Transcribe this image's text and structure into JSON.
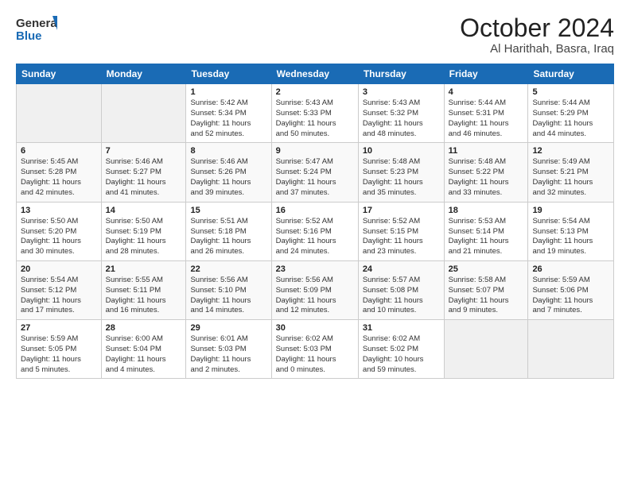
{
  "header": {
    "logo_line1": "General",
    "logo_line2": "Blue",
    "month": "October 2024",
    "location": "Al Harithah, Basra, Iraq"
  },
  "weekdays": [
    "Sunday",
    "Monday",
    "Tuesday",
    "Wednesday",
    "Thursday",
    "Friday",
    "Saturday"
  ],
  "weeks": [
    [
      {
        "day": "",
        "info": ""
      },
      {
        "day": "",
        "info": ""
      },
      {
        "day": "1",
        "info": "Sunrise: 5:42 AM\nSunset: 5:34 PM\nDaylight: 11 hours\nand 52 minutes."
      },
      {
        "day": "2",
        "info": "Sunrise: 5:43 AM\nSunset: 5:33 PM\nDaylight: 11 hours\nand 50 minutes."
      },
      {
        "day": "3",
        "info": "Sunrise: 5:43 AM\nSunset: 5:32 PM\nDaylight: 11 hours\nand 48 minutes."
      },
      {
        "day": "4",
        "info": "Sunrise: 5:44 AM\nSunset: 5:31 PM\nDaylight: 11 hours\nand 46 minutes."
      },
      {
        "day": "5",
        "info": "Sunrise: 5:44 AM\nSunset: 5:29 PM\nDaylight: 11 hours\nand 44 minutes."
      }
    ],
    [
      {
        "day": "6",
        "info": "Sunrise: 5:45 AM\nSunset: 5:28 PM\nDaylight: 11 hours\nand 42 minutes."
      },
      {
        "day": "7",
        "info": "Sunrise: 5:46 AM\nSunset: 5:27 PM\nDaylight: 11 hours\nand 41 minutes."
      },
      {
        "day": "8",
        "info": "Sunrise: 5:46 AM\nSunset: 5:26 PM\nDaylight: 11 hours\nand 39 minutes."
      },
      {
        "day": "9",
        "info": "Sunrise: 5:47 AM\nSunset: 5:24 PM\nDaylight: 11 hours\nand 37 minutes."
      },
      {
        "day": "10",
        "info": "Sunrise: 5:48 AM\nSunset: 5:23 PM\nDaylight: 11 hours\nand 35 minutes."
      },
      {
        "day": "11",
        "info": "Sunrise: 5:48 AM\nSunset: 5:22 PM\nDaylight: 11 hours\nand 33 minutes."
      },
      {
        "day": "12",
        "info": "Sunrise: 5:49 AM\nSunset: 5:21 PM\nDaylight: 11 hours\nand 32 minutes."
      }
    ],
    [
      {
        "day": "13",
        "info": "Sunrise: 5:50 AM\nSunset: 5:20 PM\nDaylight: 11 hours\nand 30 minutes."
      },
      {
        "day": "14",
        "info": "Sunrise: 5:50 AM\nSunset: 5:19 PM\nDaylight: 11 hours\nand 28 minutes."
      },
      {
        "day": "15",
        "info": "Sunrise: 5:51 AM\nSunset: 5:18 PM\nDaylight: 11 hours\nand 26 minutes."
      },
      {
        "day": "16",
        "info": "Sunrise: 5:52 AM\nSunset: 5:16 PM\nDaylight: 11 hours\nand 24 minutes."
      },
      {
        "day": "17",
        "info": "Sunrise: 5:52 AM\nSunset: 5:15 PM\nDaylight: 11 hours\nand 23 minutes."
      },
      {
        "day": "18",
        "info": "Sunrise: 5:53 AM\nSunset: 5:14 PM\nDaylight: 11 hours\nand 21 minutes."
      },
      {
        "day": "19",
        "info": "Sunrise: 5:54 AM\nSunset: 5:13 PM\nDaylight: 11 hours\nand 19 minutes."
      }
    ],
    [
      {
        "day": "20",
        "info": "Sunrise: 5:54 AM\nSunset: 5:12 PM\nDaylight: 11 hours\nand 17 minutes."
      },
      {
        "day": "21",
        "info": "Sunrise: 5:55 AM\nSunset: 5:11 PM\nDaylight: 11 hours\nand 16 minutes."
      },
      {
        "day": "22",
        "info": "Sunrise: 5:56 AM\nSunset: 5:10 PM\nDaylight: 11 hours\nand 14 minutes."
      },
      {
        "day": "23",
        "info": "Sunrise: 5:56 AM\nSunset: 5:09 PM\nDaylight: 11 hours\nand 12 minutes."
      },
      {
        "day": "24",
        "info": "Sunrise: 5:57 AM\nSunset: 5:08 PM\nDaylight: 11 hours\nand 10 minutes."
      },
      {
        "day": "25",
        "info": "Sunrise: 5:58 AM\nSunset: 5:07 PM\nDaylight: 11 hours\nand 9 minutes."
      },
      {
        "day": "26",
        "info": "Sunrise: 5:59 AM\nSunset: 5:06 PM\nDaylight: 11 hours\nand 7 minutes."
      }
    ],
    [
      {
        "day": "27",
        "info": "Sunrise: 5:59 AM\nSunset: 5:05 PM\nDaylight: 11 hours\nand 5 minutes."
      },
      {
        "day": "28",
        "info": "Sunrise: 6:00 AM\nSunset: 5:04 PM\nDaylight: 11 hours\nand 4 minutes."
      },
      {
        "day": "29",
        "info": "Sunrise: 6:01 AM\nSunset: 5:03 PM\nDaylight: 11 hours\nand 2 minutes."
      },
      {
        "day": "30",
        "info": "Sunrise: 6:02 AM\nSunset: 5:03 PM\nDaylight: 11 hours\nand 0 minutes."
      },
      {
        "day": "31",
        "info": "Sunrise: 6:02 AM\nSunset: 5:02 PM\nDaylight: 10 hours\nand 59 minutes."
      },
      {
        "day": "",
        "info": ""
      },
      {
        "day": "",
        "info": ""
      }
    ]
  ]
}
